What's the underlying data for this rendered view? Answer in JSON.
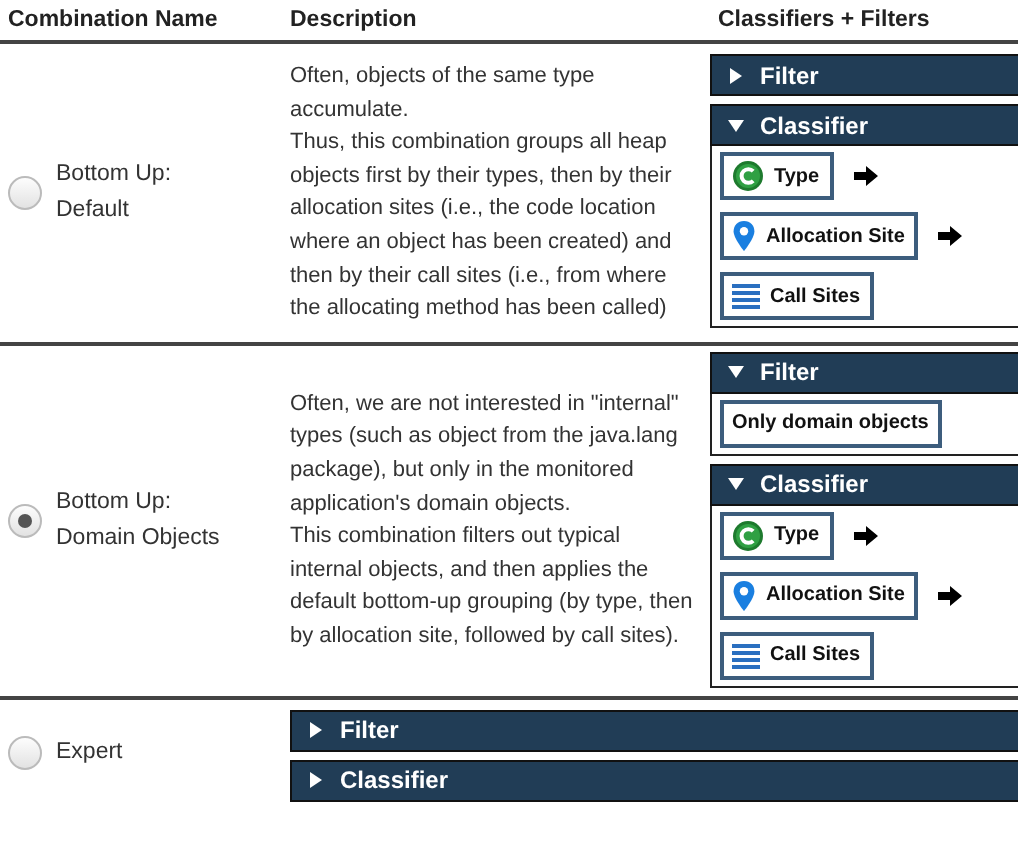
{
  "table": {
    "columns": [
      "Combination Name",
      "Description",
      "Classifiers + Filters"
    ],
    "rows": [
      {
        "name": "Bottom Up:\nDefault",
        "selected": false,
        "description": "Often, objects of the same type accumulate.\nThus, this combination groups all heap objects first by their types, then by their allocation sites (i.e., the code location where an object has been created) and then by their call sites (i.e., from where the allocating method has been called)",
        "panels": [
          {
            "title": "Filter",
            "expanded": false
          },
          {
            "title": "Classifier",
            "expanded": true,
            "items": [
              {
                "kind": "type",
                "label": "Type"
              },
              {
                "kind": "allocation",
                "label": "Allocation Site"
              },
              {
                "kind": "callsites",
                "label": "Call Sites"
              }
            ]
          }
        ]
      },
      {
        "name": "Bottom Up:\nDomain Objects",
        "selected": true,
        "description": "Often, we are not interested in \"internal\" types (such as object from the java.lang package), but only in the monitored application's domain objects.\nThis combination filters out typical internal objects, and then applies the default bottom-up grouping (by type, then by allocation site, followed by call sites).",
        "panels": [
          {
            "title": "Filter",
            "expanded": true,
            "items": [
              {
                "kind": "plain",
                "label": "Only domain objects"
              }
            ]
          },
          {
            "title": "Classifier",
            "expanded": true,
            "items": [
              {
                "kind": "type",
                "label": "Type"
              },
              {
                "kind": "allocation",
                "label": "Allocation Site"
              },
              {
                "kind": "callsites",
                "label": "Call Sites"
              }
            ]
          }
        ]
      },
      {
        "name": "Expert",
        "selected": false,
        "wide_panels": [
          {
            "title": "Filter",
            "expanded": false
          },
          {
            "title": "Classifier",
            "expanded": false
          }
        ]
      }
    ]
  }
}
